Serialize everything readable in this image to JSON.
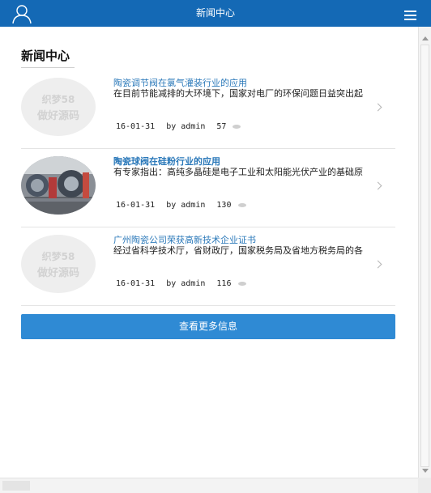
{
  "header": {
    "title": "新闻中心",
    "user_icon": "user-icon",
    "menu_icon": "hamburger-menu-icon"
  },
  "section": {
    "title": "新闻中心"
  },
  "placeholder": {
    "line1": "织梦58",
    "line2": "做好源码"
  },
  "news": [
    {
      "title": "陶瓷调节阀在氯气灌装行业的应用",
      "summary": "在目前节能减排的大环境下，国家对电厂的环保问题日益突出起",
      "date": "16-01-31",
      "author": "by admin",
      "views": "57",
      "thumbnail": "placeholder"
    },
    {
      "title": "陶瓷球阀在硅粉行业的应用",
      "summary": "有专家指出：高纯多晶硅是电子工业和太阳能光伏产业的基础原",
      "date": "16-01-31",
      "author": "by admin",
      "views": "130",
      "thumbnail": "photo"
    },
    {
      "title": "广州陶瓷公司荣获高新技术企业证书",
      "summary": "经过省科学技术厅，省财政厅，国家税务局及省地方税务局的各",
      "date": "16-01-31",
      "author": "by admin",
      "views": "116",
      "thumbnail": "placeholder"
    }
  ],
  "more_button": {
    "label": "查看更多信息"
  },
  "colors": {
    "header_bg": "#1469b5",
    "link": "#2a78b9",
    "button_bg": "#2f8ad4"
  }
}
